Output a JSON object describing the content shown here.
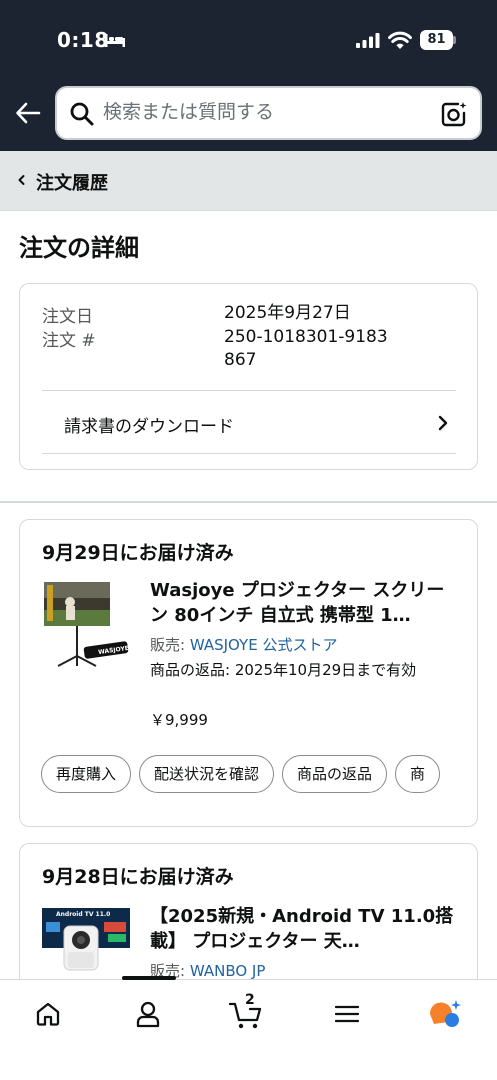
{
  "status_bar": {
    "time": "0:18",
    "battery": "81"
  },
  "search": {
    "placeholder": "検索または質問する"
  },
  "breadcrumb": {
    "label": "注文履歴"
  },
  "page": {
    "title": "注文の詳細"
  },
  "order_info": {
    "date_label": "注文日",
    "date_value": "2025年9月27日",
    "number_label": "注文 #",
    "number_value": "250-1018301-9183867",
    "invoice_label": "請求書のダウンロード"
  },
  "shipments": [
    {
      "status": "9月29日にお届け済み",
      "product_title": "Wasjoye プロジェクター スクリーン 80インチ 自立式 携帯型 1…",
      "seller_prefix": "販売: ",
      "seller_name": "WASJOYE 公式ストア",
      "returns": "商品の返品: 2025年10月29日まで有効",
      "price": "￥9,999",
      "actions": [
        "再度購入",
        "配送状況を確認",
        "商品の返品",
        "商"
      ]
    },
    {
      "status": "9月28日にお届け済み",
      "product_title": "【2025新規・Android TV 11.0搭載】 プロジェクター 天…",
      "seller_prefix": "販売: ",
      "seller_name": "WANBO JP"
    }
  ],
  "bottom_nav": {
    "cart_count": "2"
  },
  "colors": {
    "header": "#1b2430",
    "link": "#2162a1",
    "ai_orange": "#f5812a",
    "ai_blue": "#2a7de1"
  }
}
